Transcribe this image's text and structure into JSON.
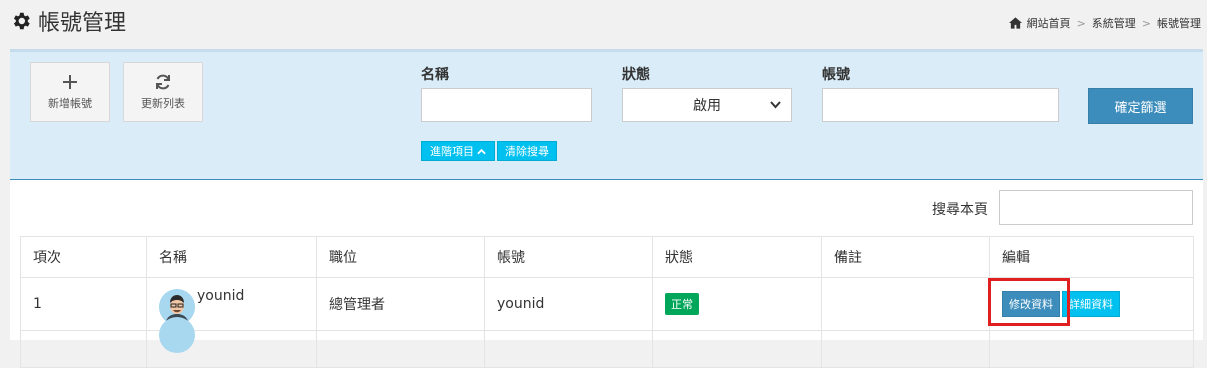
{
  "header": {
    "title": "帳號管理",
    "breadcrumb": [
      "網站首頁",
      "系統管理",
      "帳號管理"
    ],
    "breadcrumb_sep": ">"
  },
  "toolbar": {
    "add_label": "新增帳號",
    "refresh_label": "更新列表"
  },
  "filters": {
    "name_label": "名稱",
    "status_label": "狀態",
    "status_value": "啟用",
    "account_label": "帳號",
    "confirm_label": "確定篩選",
    "advanced_label": "進階項目",
    "clear_label": "清除搜尋"
  },
  "search": {
    "label": "搜尋本頁"
  },
  "table": {
    "columns": [
      "項次",
      "名稱",
      "職位",
      "帳號",
      "狀態",
      "備註",
      "編輯"
    ],
    "rows": [
      {
        "index": "1",
        "name": "younid",
        "position": "總管理者",
        "account": "younid",
        "status": "正常",
        "note": "",
        "edit_label": "修改資料",
        "detail_label": "詳細資料"
      }
    ]
  },
  "colors": {
    "primary": "#3c8dbc",
    "info": "#00c0ef",
    "success": "#00a65a",
    "highlight": "#e02020",
    "panel_bg": "#d9ecf7"
  }
}
